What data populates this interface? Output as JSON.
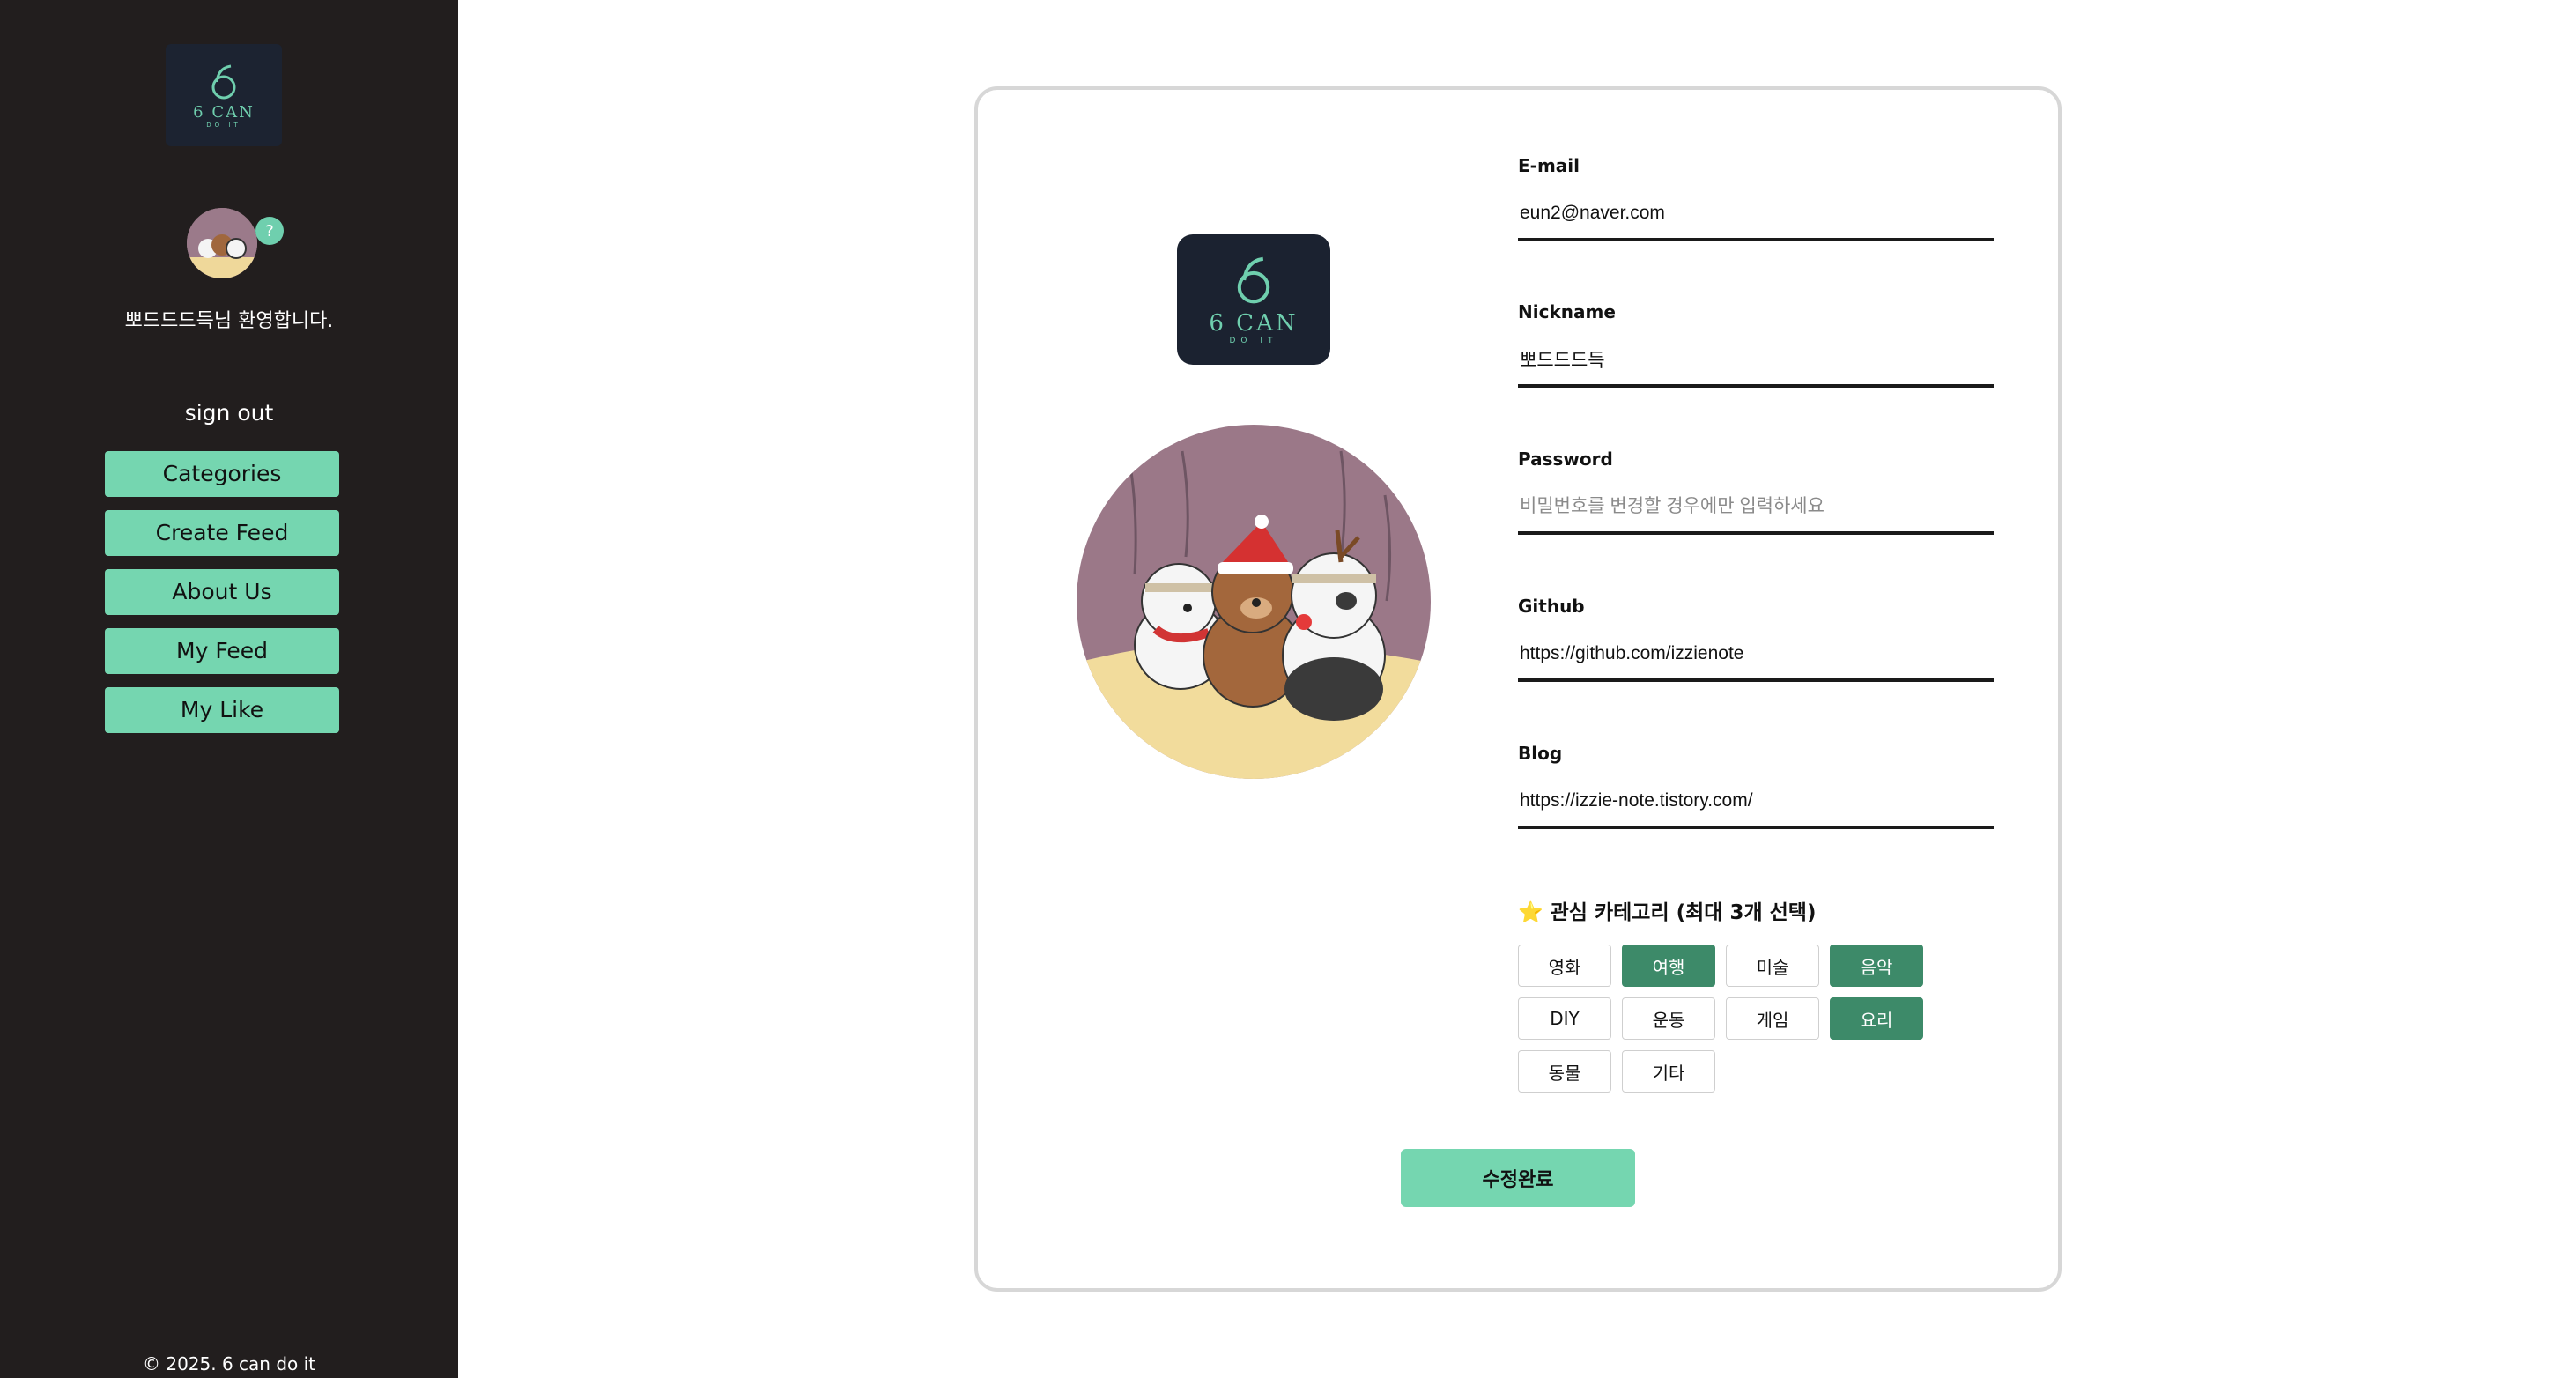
{
  "brand": {
    "logo_main": "6 CAN",
    "logo_sub": "DO IT",
    "accent_color": "#75d6b0",
    "selected_color": "#3d8a69",
    "sidebar_color": "#221e1e"
  },
  "sidebar": {
    "help_badge": "?",
    "welcome": "뽀드드드득님 환영합니다.",
    "sign_out": "sign out",
    "nav": [
      "Categories",
      "Create Feed",
      "About Us",
      "My Feed",
      "My Like"
    ],
    "copyright": "© 2025. 6 can do it"
  },
  "form": {
    "email": {
      "label": "E-mail",
      "value": "eun2@naver.com"
    },
    "nickname": {
      "label": "Nickname",
      "value": "뽀드드드득"
    },
    "password": {
      "label": "Password",
      "value": "",
      "placeholder": "비밀번호를 변경할 경우에만 입력하세요"
    },
    "github": {
      "label": "Github",
      "value": "https://github.com/izzienote"
    },
    "blog": {
      "label": "Blog",
      "value": "https://izzie-note.tistory.com/"
    },
    "categories_title": "⭐ 관심 카테고리 (최대 3개 선택)",
    "categories": [
      {
        "label": "영화",
        "selected": false
      },
      {
        "label": "여행",
        "selected": true
      },
      {
        "label": "미술",
        "selected": false
      },
      {
        "label": "음악",
        "selected": true
      },
      {
        "label": "DIY",
        "selected": false
      },
      {
        "label": "운동",
        "selected": false
      },
      {
        "label": "게임",
        "selected": false
      },
      {
        "label": "요리",
        "selected": true
      },
      {
        "label": "동물",
        "selected": false
      },
      {
        "label": "기타",
        "selected": false
      }
    ],
    "submit": "수정완료"
  }
}
